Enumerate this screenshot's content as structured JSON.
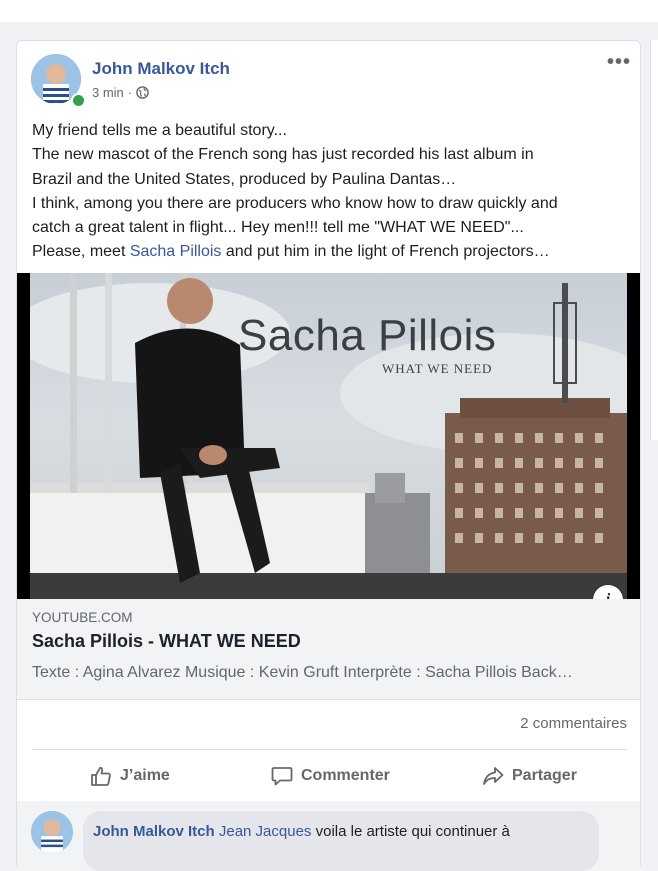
{
  "post": {
    "author": "John Malkov Itch",
    "time": "3 min",
    "separator": "·",
    "more_icon": "more-horizontal-icon",
    "privacy_icon": "globe-icon",
    "text_lines": [
      "My friend tells me a beautiful story...",
      "The new mascot of the French song has just recorded his last album in",
      "Brazil and the United States, produced by Paulina Dantas…",
      "I think, among you there are producers who know how to draw quickly and",
      "catch a great talent in flight... Hey men!!! tell me \"WHAT WE NEED\"...",
      "Please, meet "
    ],
    "mention": "Sacha Pillois",
    "text_tail": " and put him in the light of French projectors…"
  },
  "preview": {
    "image_title": "Sacha Pillois",
    "image_subtitle": "WHAT WE NEED",
    "info_label": "i"
  },
  "link": {
    "domain": "YOUTUBE.COM",
    "title": "Sacha Pillois - WHAT WE NEED",
    "description": "Texte : Agina Alvarez Musique : Kevin Gruft Interprète : Sacha Pillois Back…"
  },
  "stats": {
    "comments": "2 commentaires"
  },
  "actions": {
    "like": "J’aime",
    "comment": "Commenter",
    "share": "Partager"
  },
  "comment": {
    "author": "John Malkov Itch",
    "mention": "Jean Jacques",
    "text": " voila le artiste qui continuer à"
  },
  "colors": {
    "link_blue": "#385898",
    "online_green": "#31a24c",
    "muted": "#65676b"
  }
}
